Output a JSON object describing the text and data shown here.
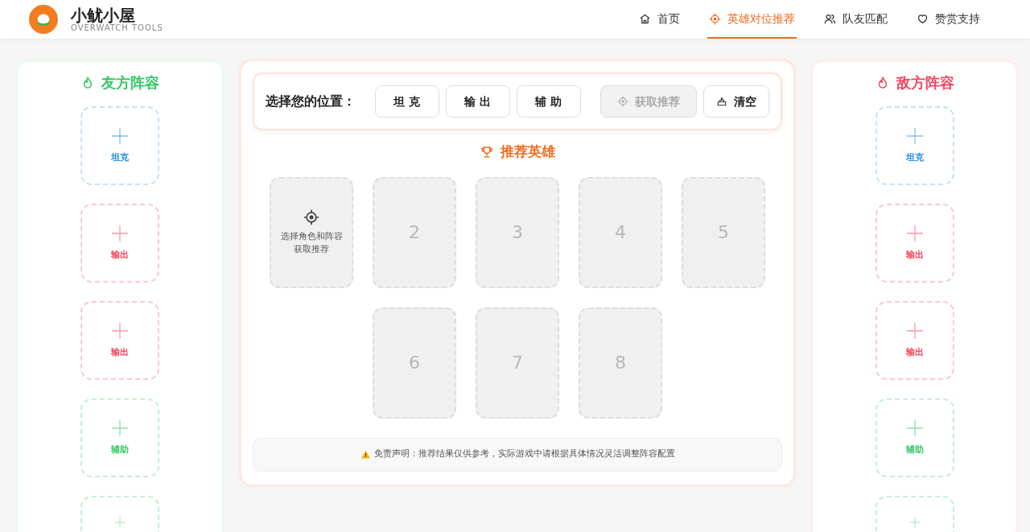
{
  "header": {
    "logo_title": "小鱿小屋",
    "logo_subtitle": "OVERWATCH TOOLS",
    "nav": [
      {
        "label": "首页",
        "selected": false
      },
      {
        "label": "英雄对位推荐",
        "selected": true
      },
      {
        "label": "队友匹配",
        "selected": false
      },
      {
        "label": "赞赏支持",
        "selected": false
      }
    ]
  },
  "ally_panel": {
    "title": "友方阵容",
    "slots": [
      {
        "kind": "tank",
        "label": "坦克"
      },
      {
        "kind": "damage",
        "label": "输出"
      },
      {
        "kind": "damage",
        "label": "输出"
      },
      {
        "kind": "support",
        "label": "辅助"
      },
      {
        "kind": "support"
      }
    ]
  },
  "center": {
    "position_label": "选择您的位置：",
    "role_buttons": [
      {
        "label": "坦 克",
        "selected": false
      },
      {
        "label": "输 出",
        "selected": false
      },
      {
        "label": "辅 助",
        "selected": false
      }
    ],
    "recommend_button": {
      "label": "获取推荐",
      "disabled": true
    },
    "clear_button": {
      "label": "清空"
    },
    "recommend_title": "推荐英雄",
    "hero_cards": [
      {
        "kind": "prompt",
        "lines": [
          "选择角色和阵容",
          "获取推荐"
        ]
      },
      {
        "kind": "number",
        "text": "2"
      },
      {
        "kind": "number",
        "text": "3"
      },
      {
        "kind": "number",
        "text": "4"
      },
      {
        "kind": "number",
        "text": "5"
      },
      {
        "kind": "number",
        "text": "6"
      },
      {
        "kind": "number",
        "text": "7"
      },
      {
        "kind": "number",
        "text": "8"
      }
    ],
    "disclaimer": "免责声明：推荐结果仅供参考，实际游戏中请根据具体情况灵活调整阵容配置"
  },
  "enemy_panel": {
    "title": "敌方阵容",
    "slots": [
      {
        "kind": "tank",
        "label": "坦克"
      },
      {
        "kind": "damage",
        "label": "输出"
      },
      {
        "kind": "damage",
        "label": "输出"
      },
      {
        "kind": "support",
        "label": "辅助"
      },
      {
        "kind": "support"
      }
    ]
  }
}
